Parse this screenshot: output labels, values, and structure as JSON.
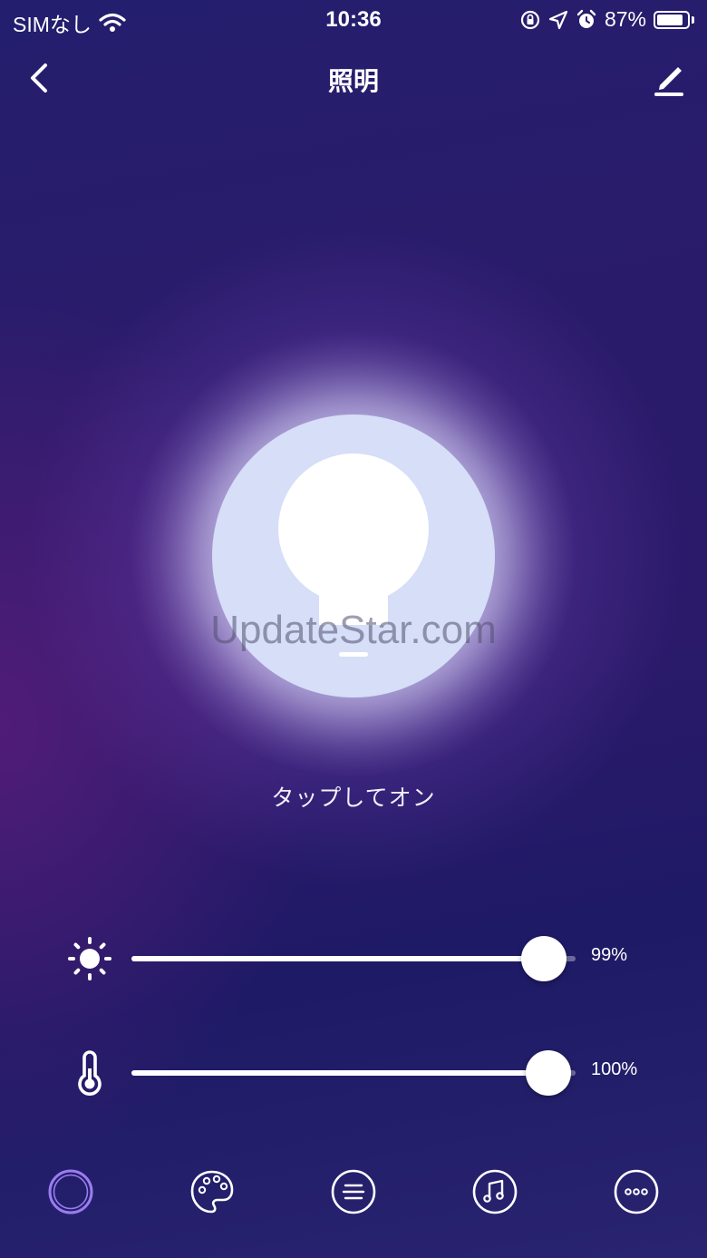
{
  "status_bar": {
    "carrier": "SIMなし",
    "time": "10:36",
    "battery_percent": "87%",
    "battery_level": 0.87
  },
  "header": {
    "title": "照明"
  },
  "bulb": {
    "watermark": "UpdateStar.com",
    "tap_label": "タップしてオン"
  },
  "sliders": {
    "brightness": {
      "icon": "sun-icon",
      "value_label": "99%",
      "level": 0.99
    },
    "color_temperature": {
      "icon": "thermometer-icon",
      "value_label": "100%",
      "level": 1.0
    }
  },
  "tabs": [
    {
      "icon": "white-light-icon",
      "active": true
    },
    {
      "icon": "palette-icon",
      "active": false
    },
    {
      "icon": "scenes-icon",
      "active": false
    },
    {
      "icon": "music-icon",
      "active": false
    },
    {
      "icon": "more-icon",
      "active": false
    }
  ],
  "colors": {
    "accent": "#9b7cf0",
    "bulb_disc": "#d6def8"
  }
}
